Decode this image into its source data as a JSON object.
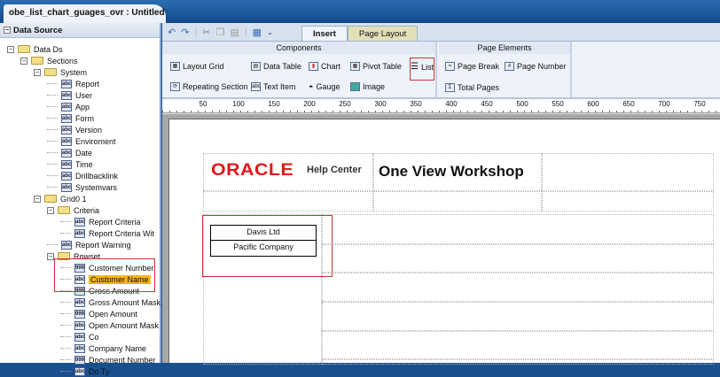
{
  "window": {
    "doc_tab": "obe_list_chart_guages_ovr : Untitled"
  },
  "data_source": {
    "title": "Data Source",
    "tree": [
      {
        "label": "Data Ds",
        "level": 0,
        "icon": "folder"
      },
      {
        "label": "Sections",
        "level": 1,
        "icon": "folder"
      },
      {
        "label": "System",
        "level": 2,
        "icon": "folder"
      },
      {
        "label": "Report",
        "level": 3,
        "icon": "abc"
      },
      {
        "label": "User",
        "level": 3,
        "icon": "abc"
      },
      {
        "label": "App",
        "level": 3,
        "icon": "abc"
      },
      {
        "label": "Form",
        "level": 3,
        "icon": "abc"
      },
      {
        "label": "Version",
        "level": 3,
        "icon": "abc"
      },
      {
        "label": "Enviroment",
        "level": 3,
        "icon": "abc"
      },
      {
        "label": "Date",
        "level": 3,
        "icon": "abc"
      },
      {
        "label": "Time",
        "level": 3,
        "icon": "abc"
      },
      {
        "label": "Drillbacklink",
        "level": 3,
        "icon": "abc"
      },
      {
        "label": "Systemvars",
        "level": 3,
        "icon": "abc"
      },
      {
        "label": "Grid0 1",
        "level": 2,
        "icon": "folder"
      },
      {
        "label": "Criteria",
        "level": 3,
        "icon": "folder"
      },
      {
        "label": "Report Criteria",
        "level": 4,
        "icon": "abc"
      },
      {
        "label": "Report Criteria Wit",
        "level": 4,
        "icon": "abc"
      },
      {
        "label": "Report Warning",
        "level": 3,
        "icon": "abc"
      },
      {
        "label": "Rowset",
        "level": 3,
        "icon": "folder"
      },
      {
        "label": "Customer Number",
        "level": 4,
        "icon": "999"
      },
      {
        "label": "Customer Name",
        "level": 4,
        "icon": "abc",
        "selected": true
      },
      {
        "label": "Gross Amount",
        "level": 4,
        "icon": "999"
      },
      {
        "label": "Gross Amount Mask",
        "level": 4,
        "icon": "abc"
      },
      {
        "label": "Open Amount",
        "level": 4,
        "icon": "999"
      },
      {
        "label": "Open Amount Mask",
        "level": 4,
        "icon": "abc"
      },
      {
        "label": "Co",
        "level": 4,
        "icon": "abc"
      },
      {
        "label": "Company Name",
        "level": 4,
        "icon": "abc"
      },
      {
        "label": "Document Number",
        "level": 4,
        "icon": "999"
      },
      {
        "label": "Do Ty",
        "level": 4,
        "icon": "abc"
      }
    ]
  },
  "tabs": {
    "insert": "Insert",
    "page_layout": "Page Layout"
  },
  "ribbon": {
    "components_title": "Components",
    "page_elements_title": "Page Elements",
    "layout_grid": "Layout Grid",
    "data_table": "Data Table",
    "chart": "Chart",
    "pivot_table": "Pivot Table",
    "list": "List",
    "repeating_section": "Repeating Section",
    "text_item": "Text Item",
    "gauge": "Gauge",
    "image": "Image",
    "page_break": "Page Break",
    "page_number": "Page Number",
    "total_pages": "Total Pages"
  },
  "ruler": [
    "50",
    "100",
    "150",
    "200",
    "250",
    "300",
    "350",
    "400",
    "450",
    "500",
    "550",
    "600",
    "650",
    "700",
    "750"
  ],
  "canvas": {
    "logo": "ORACLE",
    "help_center": "Help Center",
    "title": "One View Workshop",
    "list_items": [
      "Davis Ltd",
      "Pacific Company"
    ]
  }
}
